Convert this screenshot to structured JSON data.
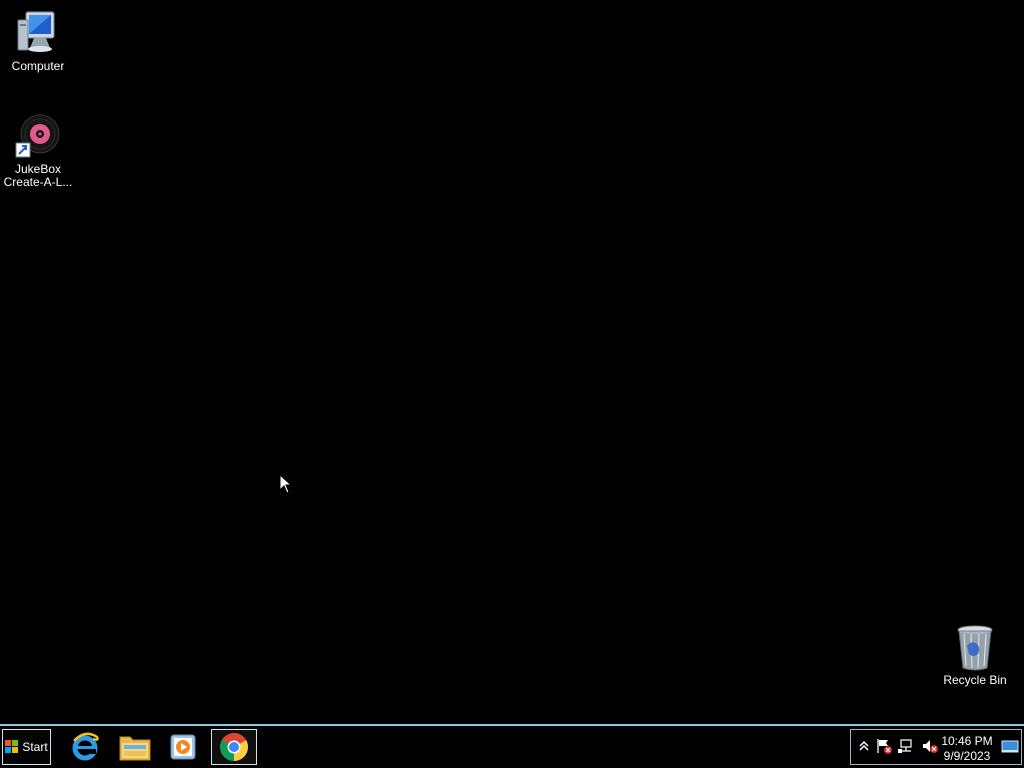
{
  "desktop": {
    "icons": [
      {
        "label": "Computer",
        "icon": "computer-icon"
      },
      {
        "label": "JukeBox\nCreate-A-L...",
        "icon": "jukebox-shortcut-icon"
      },
      {
        "label": "Recycle Bin",
        "icon": "recycle-bin-icon"
      }
    ]
  },
  "taskbar": {
    "start_label": "Start",
    "apps": [
      {
        "icon": "internet-explorer-icon"
      },
      {
        "icon": "file-explorer-icon"
      },
      {
        "icon": "media-player-icon"
      },
      {
        "icon": "chrome-icon"
      }
    ],
    "tray": {
      "icons": [
        "show-hidden-icons-chevron",
        "action-center-flag-icon",
        "network-icon",
        "volume-muted-icon"
      ],
      "time": "10:46 PM",
      "date": "9/9/2023"
    }
  },
  "colors": {
    "background": "#000000",
    "taskbar_border": "#8fc9dd"
  }
}
